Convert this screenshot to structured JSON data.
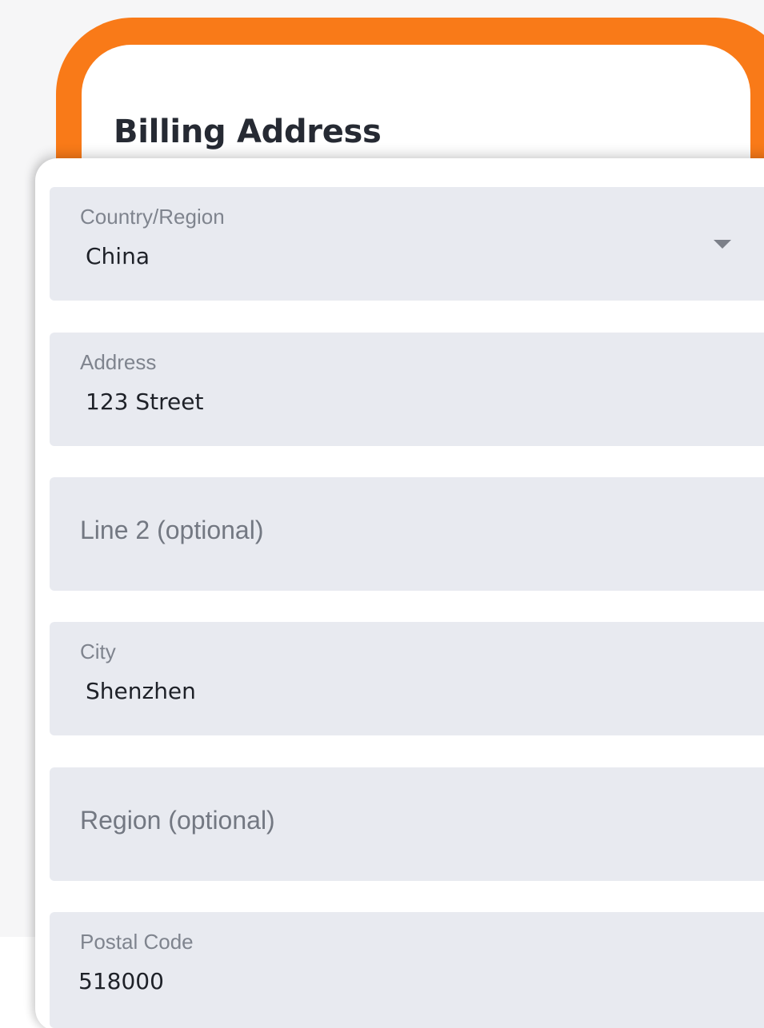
{
  "section": {
    "title": "Billing Address"
  },
  "fields": {
    "country": {
      "label": "Country/Region",
      "value": "China"
    },
    "address": {
      "label": "Address",
      "value": "123 Street"
    },
    "line2": {
      "placeholder": "Line 2 (optional)"
    },
    "city": {
      "label": "City",
      "value": "Shenzhen"
    },
    "region": {
      "placeholder": "Region (optional)"
    },
    "postal_code": {
      "label": "Postal Code",
      "value": "518000"
    }
  },
  "colors": {
    "highlight": "#f97a18",
    "field_background": "#e8eaf0",
    "card_background": "#ffffff"
  },
  "icons": {
    "country_dropdown": "chevron-down-icon"
  }
}
